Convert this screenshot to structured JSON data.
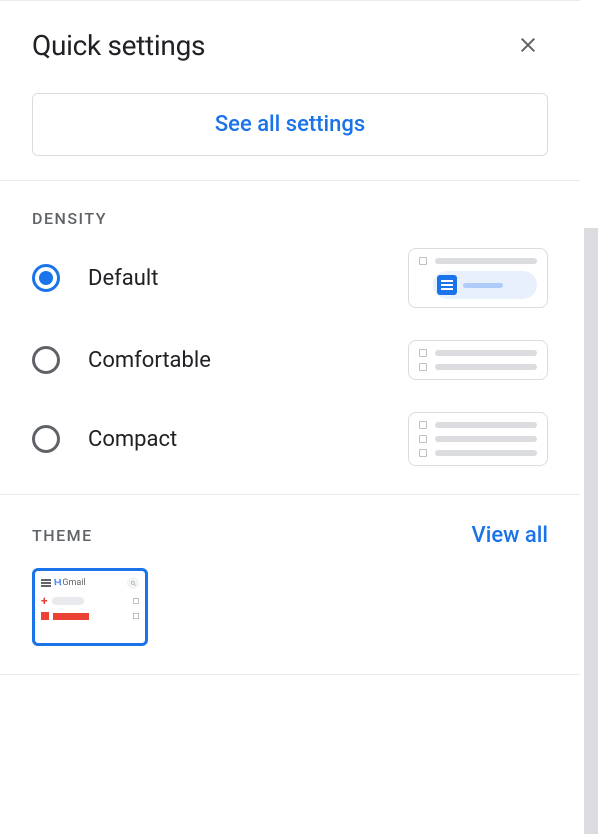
{
  "header": {
    "title": "Quick settings"
  },
  "buttons": {
    "see_all": "See all settings"
  },
  "density": {
    "section_title": "Density",
    "options": {
      "default": "Default",
      "comfortable": "Comfortable",
      "compact": "Compact"
    },
    "selected": "default"
  },
  "theme": {
    "section_title": "Theme",
    "view_all": "View all",
    "gmail_label": "Gmail"
  }
}
